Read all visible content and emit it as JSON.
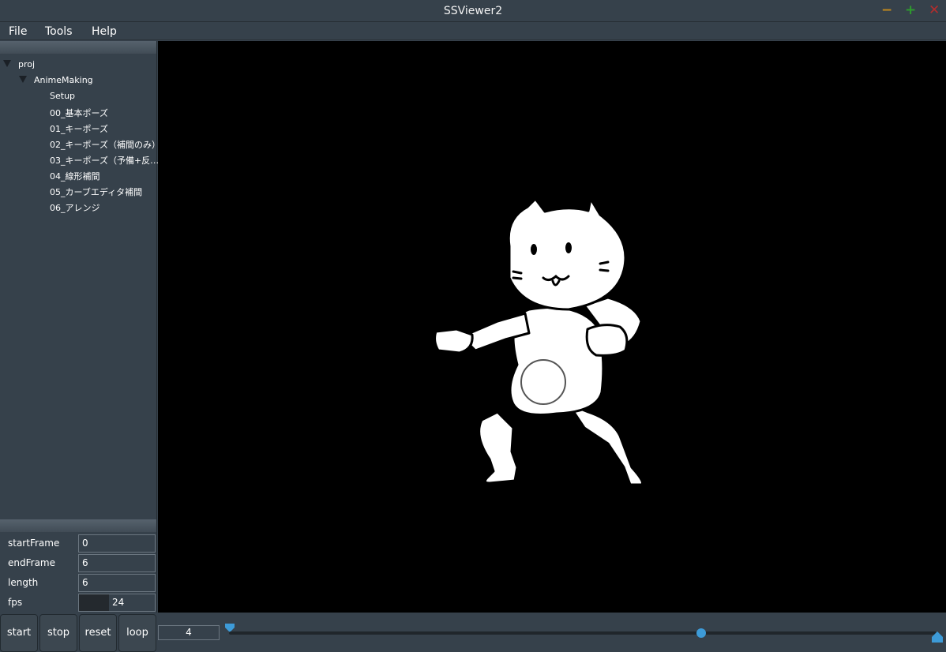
{
  "window": {
    "title": "SSViewer2"
  },
  "menu": [
    "File",
    "Tools",
    "Help"
  ],
  "tree": {
    "root": "proj",
    "folder": "AnimeMaking",
    "items": [
      "Setup",
      "00_基本ポーズ",
      "01_キーポーズ",
      "02_キーポーズ（補間のみ）",
      "03_キーポーズ（予備+反…",
      "04_線形補間",
      "05_カーブエディタ補間",
      "06_アレンジ"
    ]
  },
  "properties": {
    "startFrame": {
      "label": "startFrame",
      "value": "0"
    },
    "endFrame": {
      "label": "endFrame",
      "value": "6"
    },
    "length": {
      "label": "length",
      "value": "6"
    },
    "fps": {
      "label": "fps",
      "value": "24"
    }
  },
  "controls": {
    "start": "start",
    "stop": "stop",
    "reset": "reset",
    "loop": "loop",
    "current_frame": "4"
  },
  "timeline": {
    "position_fraction": 0.667
  },
  "colors": {
    "background": "#36414b",
    "viewport": "#000000",
    "accent": "#3d9bd8",
    "minimize": "#c38a1d",
    "maximize": "#2e9a2e",
    "close": "#b22d2d"
  },
  "icons": [
    "minimize-icon",
    "maximize-icon",
    "close-icon",
    "expand-triangle-icon",
    "timeline-start-marker-icon",
    "timeline-end-marker-icon"
  ]
}
